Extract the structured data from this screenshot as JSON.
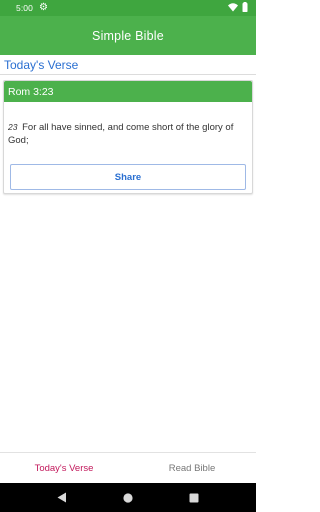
{
  "status_bar": {
    "time": "5:00",
    "icons": [
      "gear-icon",
      "wifi-icon",
      "battery-icon"
    ]
  },
  "app_bar": {
    "title": "Simple Bible"
  },
  "section": {
    "title": "Today's Verse"
  },
  "verse_card": {
    "reference": "Rom 3:23",
    "verse_number": "23",
    "verse_text": "For all have sinned, and come short of the glory of God;",
    "share_label": "Share"
  },
  "tabs": [
    {
      "label": "Today's Verse",
      "active": true
    },
    {
      "label": "Read Bible",
      "active": false
    }
  ],
  "nav_bar": {
    "buttons": [
      "back-icon",
      "home-icon",
      "recents-icon"
    ]
  },
  "colors": {
    "status_bar": "#3fa63f",
    "app_bar": "#4cb14c",
    "accent_blue": "#2a6fd1",
    "active_tab": "#c2185b"
  }
}
